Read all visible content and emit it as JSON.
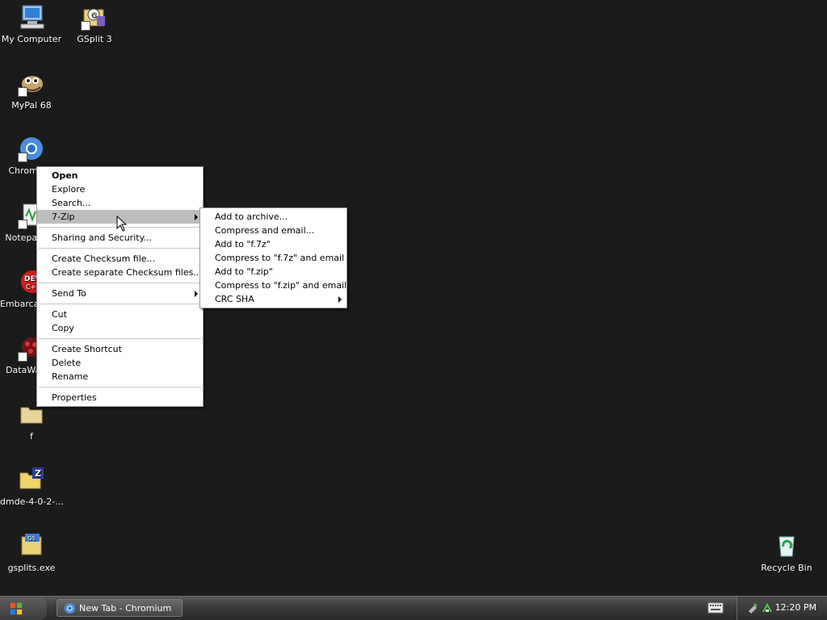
{
  "desktop_icons": [
    {
      "label": "My Computer",
      "icon": "computer-icon"
    },
    {
      "label": "GSplit 3",
      "icon": "gsplit-icon"
    },
    {
      "label": "MyPal 68",
      "icon": "mypal-icon"
    },
    {
      "label": "Chromium",
      "icon": "chromium-icon"
    },
    {
      "label": "Notepad++",
      "icon": "notepad-icon"
    },
    {
      "label": "Embarcadero Dev-C++",
      "icon": "devcpp-icon"
    },
    {
      "label": "DataWagon",
      "icon": "datawagon-icon"
    },
    {
      "label": "f",
      "icon": "folder-icon"
    },
    {
      "label": "dmde-4-0-2-...",
      "icon": "zip-folder-icon"
    },
    {
      "label": "gsplits.exe",
      "icon": "exe-icon"
    },
    {
      "label": "Recycle Bin",
      "icon": "recycle-bin-icon"
    }
  ],
  "context_menu": {
    "items": [
      {
        "label": "Open"
      },
      {
        "label": "Explore"
      },
      {
        "label": "Search..."
      },
      {
        "label": "7-Zip"
      },
      {
        "label": "Sharing and Security..."
      },
      {
        "label": "Create Checksum file..."
      },
      {
        "label": "Create separate Checksum files..."
      },
      {
        "label": "Send To"
      },
      {
        "label": "Cut"
      },
      {
        "label": "Copy"
      },
      {
        "label": "Create Shortcut"
      },
      {
        "label": "Delete"
      },
      {
        "label": "Rename"
      },
      {
        "label": "Properties"
      }
    ]
  },
  "submenu_7zip": {
    "items": [
      {
        "label": "Add to archive..."
      },
      {
        "label": "Compress and email..."
      },
      {
        "label": "Add to \"f.7z\""
      },
      {
        "label": "Compress to \"f.7z\" and email"
      },
      {
        "label": "Add to \"f.zip\""
      },
      {
        "label": "Compress to \"f.zip\" and email"
      },
      {
        "label": "CRC SHA"
      }
    ]
  },
  "taskbar": {
    "task_label": "New Tab - Chromium",
    "clock": "12:20 PM"
  },
  "colors": {
    "desktop_bg": "#1b1b1b",
    "menu_highlight": "#bdbdbd"
  }
}
